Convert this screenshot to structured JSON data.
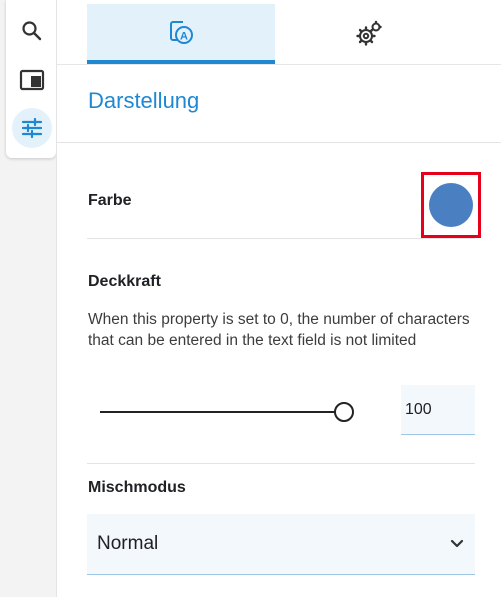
{
  "rail": {
    "items": [
      {
        "icon": "search-icon"
      },
      {
        "icon": "panel-icon"
      },
      {
        "icon": "sliders-icon",
        "active": true
      }
    ]
  },
  "tabs": [
    {
      "icon": "text-style-icon",
      "active": true
    },
    {
      "icon": "gears-icon",
      "active": false
    }
  ],
  "section": {
    "title": "Darstellung"
  },
  "color": {
    "label": "Farbe",
    "value": "#4a7fc1"
  },
  "opacity": {
    "label": "Deckkraft",
    "description": "When this property is set to 0, the number of characters that can be entered in the text field is not limited",
    "slider_value": 100,
    "input_value": "100"
  },
  "blend": {
    "label": "Mischmodus",
    "selected": "Normal"
  },
  "colors": {
    "accent": "#1e88d2",
    "highlight": "#e6001c"
  }
}
